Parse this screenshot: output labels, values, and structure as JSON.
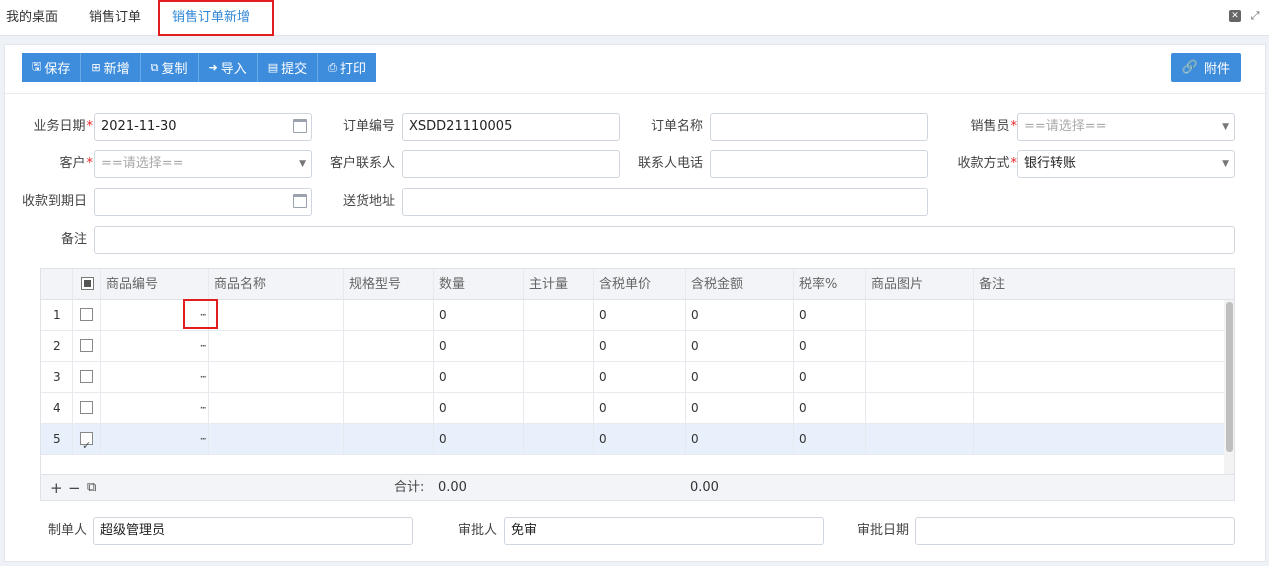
{
  "tabs": [
    {
      "label": "我的桌面"
    },
    {
      "label": "销售订单"
    },
    {
      "label": "销售订单新增"
    }
  ],
  "toolbar": {
    "save": "保存",
    "add": "新增",
    "copy": "复制",
    "import": "导入",
    "submit": "提交",
    "print": "打印",
    "attachment": "附件"
  },
  "form": {
    "biz_date_label": "业务日期",
    "biz_date_value": "2021-11-30",
    "order_no_label": "订单编号",
    "order_no_value": "XSDD21110005",
    "order_name_label": "订单名称",
    "order_name_value": "",
    "salesman_label": "销售员",
    "salesman_placeholder": "==请选择==",
    "customer_label": "客户",
    "customer_placeholder": "==请选择==",
    "contact_label": "客户联系人",
    "contact_value": "",
    "phone_label": "联系人电话",
    "phone_value": "",
    "pay_method_label": "收款方式",
    "pay_method_value": "银行转账",
    "due_date_label": "收款到期日",
    "due_date_value": "",
    "address_label": "送货地址",
    "address_value": "",
    "remark_label": "备注",
    "remark_value": ""
  },
  "grid": {
    "columns": [
      "商品编号",
      "商品名称",
      "规格型号",
      "数量",
      "主计量",
      "含税单价",
      "含税金额",
      "税率%",
      "商品图片",
      "备注"
    ],
    "rows": [
      {
        "num": "1",
        "checked": false,
        "qty": "0",
        "price": "0",
        "amount": "0",
        "tax": "0"
      },
      {
        "num": "2",
        "checked": false,
        "qty": "0",
        "price": "0",
        "amount": "0",
        "tax": "0"
      },
      {
        "num": "3",
        "checked": false,
        "qty": "0",
        "price": "0",
        "amount": "0",
        "tax": "0"
      },
      {
        "num": "4",
        "checked": false,
        "qty": "0",
        "price": "0",
        "amount": "0",
        "tax": "0"
      },
      {
        "num": "5",
        "checked": true,
        "qty": "0",
        "price": "0",
        "amount": "0",
        "tax": "0"
      }
    ],
    "dots": "···",
    "total_label": "合计:",
    "total_qty": "0.00",
    "total_amount": "0.00"
  },
  "footer": {
    "maker_label": "制单人",
    "maker_value": "超级管理员",
    "approver_label": "审批人",
    "approver_value": "免审",
    "approve_date_label": "审批日期",
    "approve_date_value": ""
  }
}
